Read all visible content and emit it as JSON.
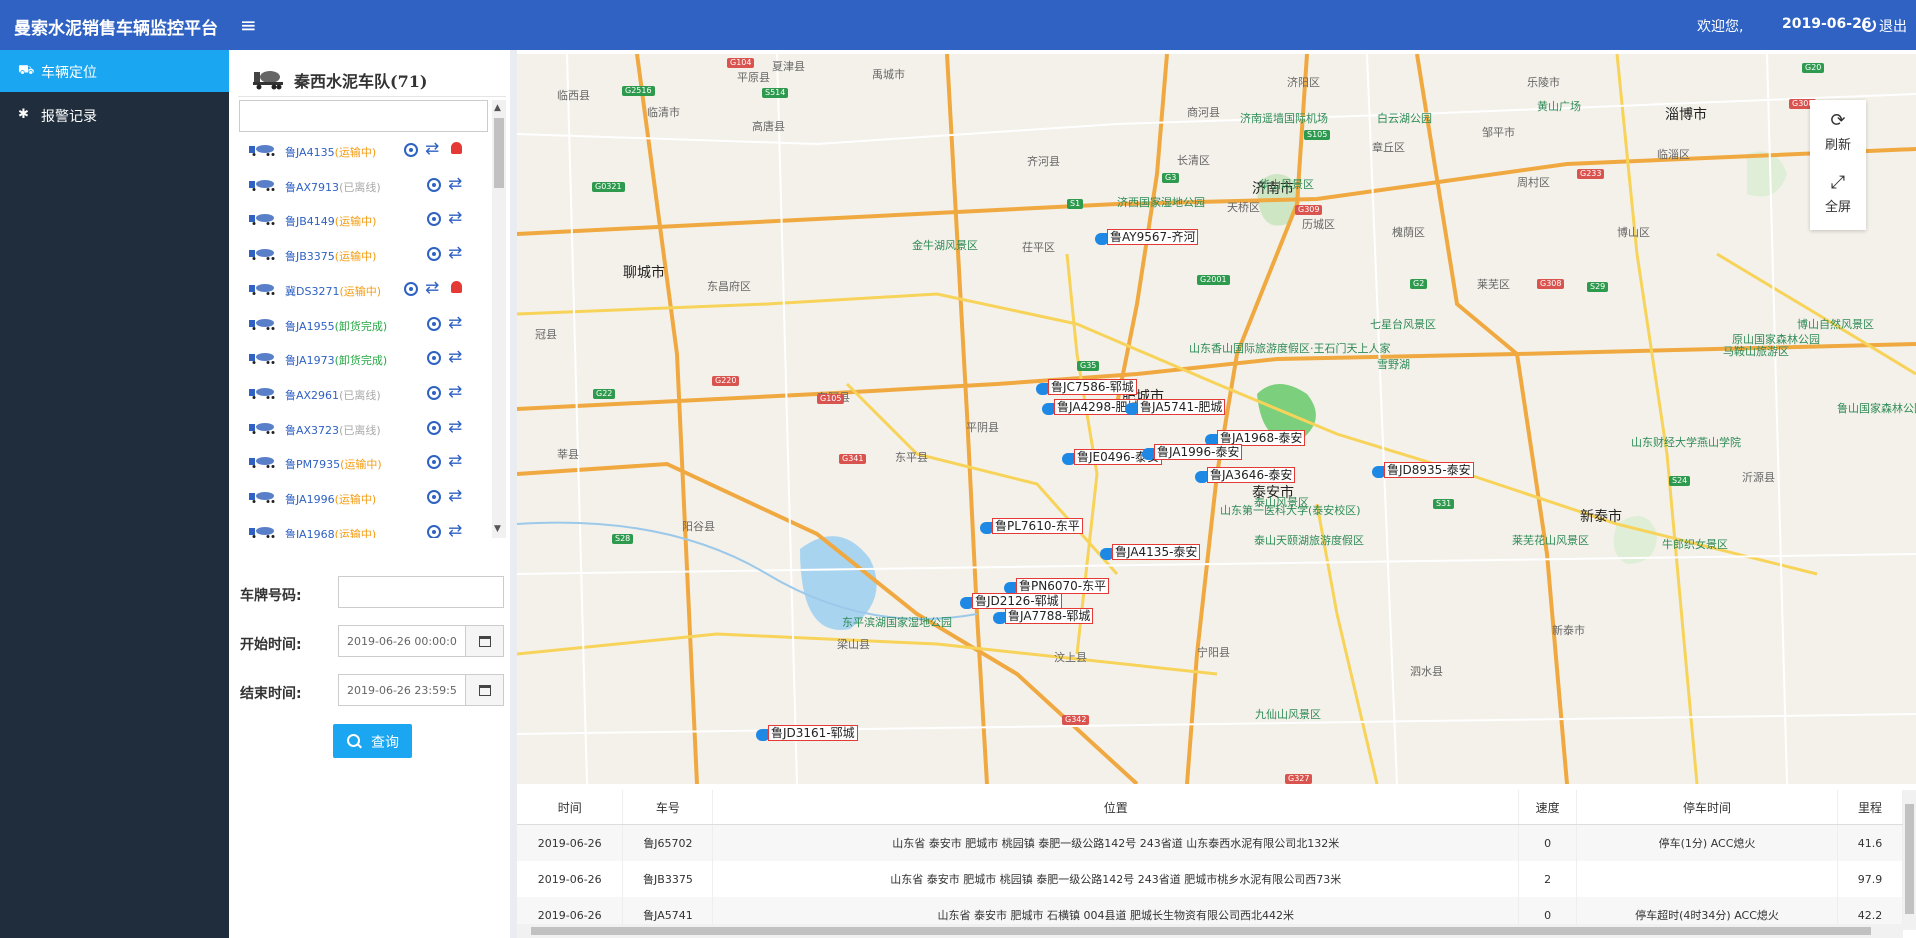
{
  "app": {
    "title": "曼索水泥销售车辆监控平台",
    "welcome": "欢迎您,",
    "date": "2019-06-26",
    "logout": "退出"
  },
  "sidebar": {
    "items": [
      {
        "label": "车辆定位",
        "icon": "truck-icon",
        "active": true
      },
      {
        "label": "报警记录",
        "icon": "bug-icon",
        "active": false
      }
    ]
  },
  "fleet": {
    "title": "秦西水泥车队(71)",
    "vehicles": [
      {
        "plate": "鲁JA4135",
        "status": "(运输中)",
        "state": "run",
        "alarm": true
      },
      {
        "plate": "鲁AX7913",
        "status": "(已离线)",
        "state": "off",
        "alarm": false
      },
      {
        "plate": "鲁JB4149",
        "status": "(运输中)",
        "state": "run",
        "alarm": false
      },
      {
        "plate": "鲁JB3375",
        "status": "(运输中)",
        "state": "run",
        "alarm": false
      },
      {
        "plate": "冀DS3271",
        "status": "(运输中)",
        "state": "run",
        "alarm": true
      },
      {
        "plate": "鲁JA1955",
        "status": "(卸货完成)",
        "state": "done",
        "alarm": false
      },
      {
        "plate": "鲁JA1973",
        "status": "(卸货完成)",
        "state": "done",
        "alarm": false
      },
      {
        "plate": "鲁AX2961",
        "status": "(已离线)",
        "state": "off",
        "alarm": false
      },
      {
        "plate": "鲁AX3723",
        "status": "(已离线)",
        "state": "off",
        "alarm": false
      },
      {
        "plate": "鲁PM7935",
        "status": "(运输中)",
        "state": "run",
        "alarm": false
      },
      {
        "plate": "鲁JA1996",
        "status": "(运输中)",
        "state": "run",
        "alarm": false
      },
      {
        "plate": "鲁JA1968",
        "status": "(运输中)",
        "state": "run",
        "alarm": false
      }
    ]
  },
  "form": {
    "plate_label": "车牌号码:",
    "plate_value": "",
    "start_label": "开始时间:",
    "start_value": "2019-06-26 00:00:0",
    "end_label": "结束时间:",
    "end_value": "2019-06-26 23:59:5",
    "query": "查询"
  },
  "map": {
    "tools": {
      "refresh": "刷新",
      "fullscreen": "全屏"
    },
    "cities": [
      "济南市",
      "聊城市",
      "肥城市",
      "淄博市",
      "泰安市",
      "新泰市"
    ],
    "towns": [
      "夏津县",
      "临西县",
      "临清市",
      "高唐县",
      "齐河县",
      "东阿县",
      "平阴县",
      "阳谷县",
      "冠县",
      "莘县",
      "东昌府区",
      "茌平区",
      "长清区",
      "章丘区",
      "邹平市",
      "博山区",
      "莱芜区",
      "梁山县",
      "汶上县",
      "宁阳县",
      "东平县",
      "泗水县",
      "新泰市",
      "济阳区",
      "周村区",
      "历城区",
      "槐荫区",
      "天桥区",
      "临淄区",
      "沂源县",
      "平原县",
      "禹城市",
      "商河县",
      "乐陵市"
    ],
    "pois": [
      "济南遥墙国际机场",
      "白云湖公园",
      "黄山广场",
      "华山风景区",
      "金牛湖风景区",
      "七星台风景区",
      "山东香山国际旅游度假区·王石门天上人家",
      "泰山风景区",
      "东平滨湖国家湿地公园",
      "九仙山风景区",
      "莱芜花山风景区",
      "牛郎织女景区",
      "山东财经大学燕山学院",
      "山东第一医科大学(泰安校区)",
      "泰山天颐湖旅游度假区",
      "博山自然风景区",
      "鲁山国家森林公园",
      "原山国家森林公园",
      "马鞍山旅游区",
      "济西国家湿地公园",
      "雪野湖"
    ],
    "markers": [
      "鲁AY9567-齐河",
      "鲁JC7586-郓城",
      "鲁JA4298-肥城",
      "鲁JA5741-肥城",
      "鲁JA1968-泰安",
      "鲁JE0496-泰安",
      "鲁JA1996-泰安",
      "鲁JA3646-泰安",
      "鲁JD8935-泰安",
      "鲁PL7610-东平",
      "鲁JA4135-泰安",
      "鲁PN6070-东平",
      "鲁JD2126-郓城",
      "鲁JA7788-郓城",
      "鲁JD3161-郓城"
    ],
    "roads": [
      "G104",
      "G220",
      "G105",
      "G35",
      "G3",
      "G2001",
      "G2",
      "S29",
      "G22",
      "G341",
      "S31",
      "G342",
      "G327",
      "G308",
      "G309",
      "G233",
      "G20",
      "S514",
      "G2516",
      "G0321",
      "S1",
      "S105",
      "G308",
      "S28",
      "S24"
    ]
  },
  "table": {
    "columns": [
      "时间",
      "车号",
      "位置",
      "速度",
      "停车时间",
      "里程"
    ],
    "rows": [
      [
        "2019-06-26",
        "鲁J65702",
        "山东省 泰安市 肥城市 桃园镇 泰肥一级公路142号 243省道 山东泰西水泥有限公司北132米",
        "0",
        "停车(1分) ACC熄火",
        "41.6"
      ],
      [
        "2019-06-26",
        "鲁JB3375",
        "山东省 泰安市 肥城市 桃园镇 泰肥一级公路142号 243省道 肥城市桃乡水泥有限公司西73米",
        "2",
        "",
        "97.9"
      ],
      [
        "2019-06-26",
        "鲁JA5741",
        "山东省 泰安市 肥城市 石横镇 004县道 肥城长生物资有限公司西北442米",
        "0",
        "停车超时(4时34分) ACC熄火",
        "42.2"
      ]
    ]
  },
  "colors": {
    "topbar": "#2f62c3",
    "sidebar": "#1f2d3d",
    "active": "#1aa6f0",
    "accent": "#1aa6f0",
    "running": "#f39c12",
    "offline": "#aaaaaa",
    "done": "#28a745",
    "alarm": "#e53935"
  }
}
